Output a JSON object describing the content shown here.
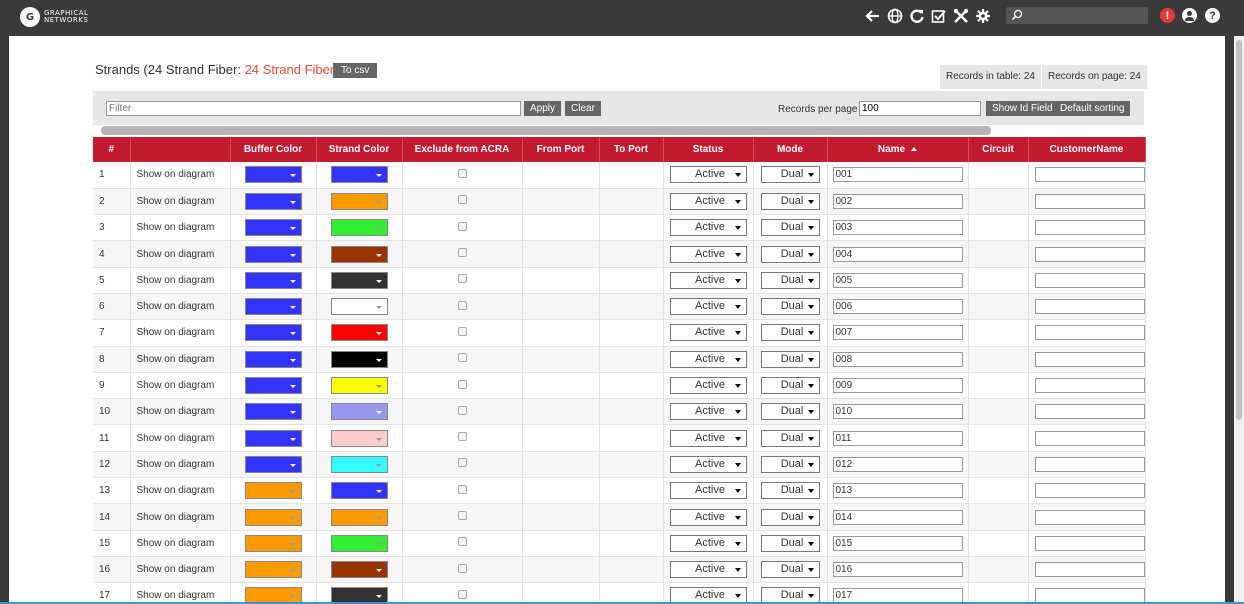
{
  "app": {
    "logo_mark": "G",
    "logo_line1": "GRAPHICAL",
    "logo_line2": "NETWORKS"
  },
  "topbar": {
    "icons": [
      "back-arrow-icon",
      "globe-icon",
      "refresh-icon",
      "checkbox-icon",
      "tools-icon",
      "gear-icon"
    ],
    "search_value": "",
    "alert_mark": "!",
    "help_mark": "?"
  },
  "page": {
    "title_prefix": "Strands (24 Strand Fiber: ",
    "title_link": "24 Strand Fiber",
    "title_suffix": ")",
    "csv_button": "To csv",
    "records_in_table": "Records in table: 24",
    "records_on_page": "Records on page: 24"
  },
  "filter": {
    "placeholder": "Filter",
    "apply": "Apply",
    "clear": "Clear",
    "rpp_label": "Records per page",
    "rpp_value": "100",
    "show_id": "Show Id Field",
    "default_sorting": "Default sorting"
  },
  "table": {
    "headers": [
      "#",
      "",
      "Buffer Color",
      "Strand Color",
      "Exclude from ACRA",
      "From Port",
      "To Port",
      "Status",
      "Mode",
      "Name",
      "Circuit",
      "CustomerName"
    ],
    "link_text": "Show on diagram",
    "status_value": "Active",
    "mode_value": "Dual",
    "rows": [
      {
        "n": "1",
        "buffer": "#3333ff",
        "strand": "#3333ff",
        "name": "001"
      },
      {
        "n": "2",
        "buffer": "#3333ff",
        "strand": "#ff9900",
        "name": "002"
      },
      {
        "n": "3",
        "buffer": "#3333ff",
        "strand": "#33ee33",
        "name": "003"
      },
      {
        "n": "4",
        "buffer": "#3333ff",
        "strand": "#993300",
        "name": "004"
      },
      {
        "n": "5",
        "buffer": "#3333ff",
        "strand": "#333333",
        "name": "005"
      },
      {
        "n": "6",
        "buffer": "#3333ff",
        "strand": "#ffffff",
        "name": "006"
      },
      {
        "n": "7",
        "buffer": "#3333ff",
        "strand": "#ff0000",
        "name": "007"
      },
      {
        "n": "8",
        "buffer": "#3333ff",
        "strand": "#000000",
        "name": "008"
      },
      {
        "n": "9",
        "buffer": "#3333ff",
        "strand": "#ffff00",
        "name": "009"
      },
      {
        "n": "10",
        "buffer": "#3333ff",
        "strand": "#9999ee",
        "name": "010"
      },
      {
        "n": "11",
        "buffer": "#3333ff",
        "strand": "#ffcccc",
        "name": "011"
      },
      {
        "n": "12",
        "buffer": "#3333ff",
        "strand": "#33ffff",
        "name": "012"
      },
      {
        "n": "13",
        "buffer": "#ff9900",
        "strand": "#3333ff",
        "name": "013"
      },
      {
        "n": "14",
        "buffer": "#ff9900",
        "strand": "#ff9900",
        "name": "014"
      },
      {
        "n": "15",
        "buffer": "#ff9900",
        "strand": "#33ee33",
        "name": "015"
      },
      {
        "n": "16",
        "buffer": "#ff9900",
        "strand": "#993300",
        "name": "016"
      },
      {
        "n": "17",
        "buffer": "#ff9900",
        "strand": "#333333",
        "name": "017"
      }
    ]
  }
}
